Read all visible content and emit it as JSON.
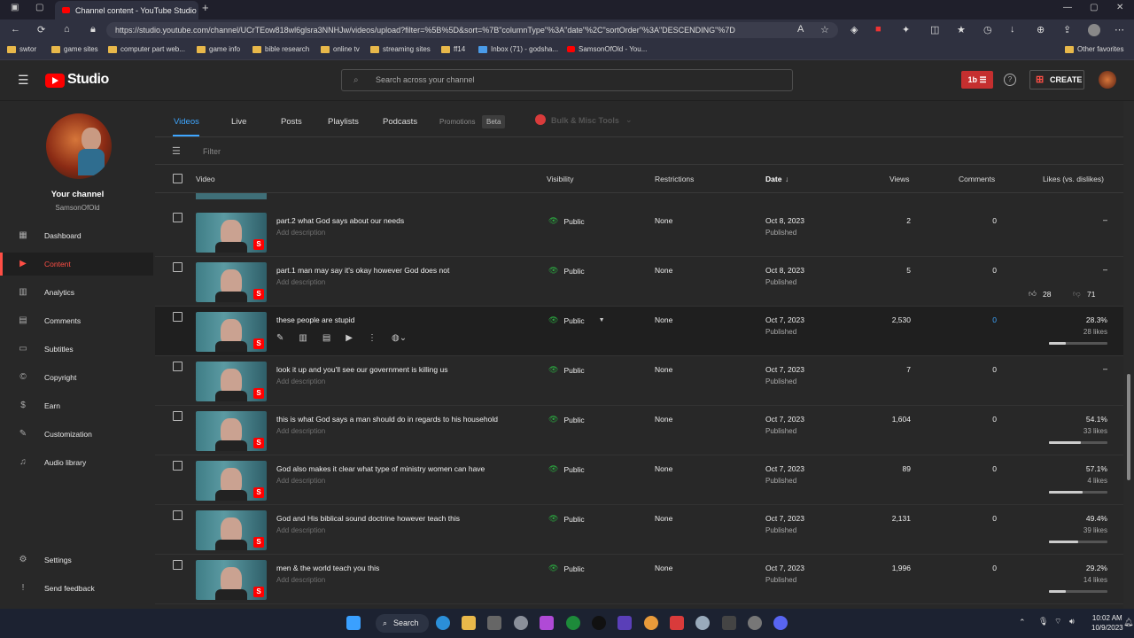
{
  "browser": {
    "tab_title": "Channel content - YouTube Studio",
    "url": "https://studio.youtube.com/channel/UCrTEow818wl6glsra3NNHJw/videos/upload?filter=%5B%5D&sort=%7B\"columnType\"%3A\"date\"%2C\"sortOrder\"%3A\"DESCENDING\"%7D",
    "bookmarks": [
      "swtor",
      "game sites",
      "computer part web...",
      "game info",
      "bible research",
      "online tv",
      "streaming sites",
      "ff14",
      "Inbox (71) - godsha...",
      "SamsonOfOld - You..."
    ],
    "other_favorites": "Other favorites"
  },
  "header": {
    "logo": "Studio",
    "search_placeholder": "Search across your channel",
    "create_label": "CREATE"
  },
  "sidebar": {
    "your_channel": "Your channel",
    "channel_name": "SamsonOfOld",
    "items": [
      {
        "label": "Dashboard",
        "icon": "dashboard-icon"
      },
      {
        "label": "Content",
        "icon": "content-icon",
        "active": true
      },
      {
        "label": "Analytics",
        "icon": "analytics-icon"
      },
      {
        "label": "Comments",
        "icon": "comments-icon"
      },
      {
        "label": "Subtitles",
        "icon": "subtitles-icon"
      },
      {
        "label": "Copyright",
        "icon": "copyright-icon"
      },
      {
        "label": "Earn",
        "icon": "earn-icon"
      },
      {
        "label": "Customization",
        "icon": "customization-icon"
      },
      {
        "label": "Audio library",
        "icon": "audio-library-icon"
      }
    ],
    "settings": "Settings",
    "feedback": "Send feedback"
  },
  "tabs": {
    "videos": "Videos",
    "live": "Live",
    "posts": "Posts",
    "playlists": "Playlists",
    "podcasts": "Podcasts",
    "promotions": "Promotions",
    "beta": "Beta",
    "bulk": "Bulk & Misc Tools"
  },
  "filter_placeholder": "Filter",
  "columns": {
    "video": "Video",
    "visibility": "Visibility",
    "restrictions": "Restrictions",
    "date": "Date",
    "views": "Views",
    "comments": "Comments",
    "likes": "Likes (vs. dislikes)"
  },
  "tooltip": {
    "likes": "28",
    "dislikes": "71"
  },
  "rows": [
    {
      "title": "part.2 what God says about our needs",
      "desc": "Add description",
      "visibility": "Public",
      "restrictions": "None",
      "date": "Oct 8, 2023",
      "status": "Published",
      "views": "2",
      "comments": "0",
      "likes_pct": "–",
      "likes_count": "",
      "bar": 0
    },
    {
      "title": "part.1 man may say it's okay however God does not",
      "desc": "Add description",
      "visibility": "Public",
      "restrictions": "None",
      "date": "Oct 8, 2023",
      "status": "Published",
      "views": "5",
      "comments": "0",
      "likes_pct": "–",
      "likes_count": "",
      "bar": 0
    },
    {
      "title": "these people are stupid",
      "desc": "",
      "visibility": "Public",
      "restrictions": "None",
      "date": "Oct 7, 2023",
      "status": "Published",
      "views": "2,530",
      "comments": "0",
      "likes_pct": "28.3%",
      "likes_count": "28 likes",
      "bar": 0.283
    },
    {
      "title": "look it up and you'll see our government is killing us",
      "desc": "Add description",
      "visibility": "Public",
      "restrictions": "None",
      "date": "Oct 7, 2023",
      "status": "Published",
      "views": "7",
      "comments": "0",
      "likes_pct": "–",
      "likes_count": "",
      "bar": 0
    },
    {
      "title": "this is what God says a man should do in regards to his household",
      "desc": "Add description",
      "visibility": "Public",
      "restrictions": "None",
      "date": "Oct 7, 2023",
      "status": "Published",
      "views": "1,604",
      "comments": "0",
      "likes_pct": "54.1%",
      "likes_count": "33 likes",
      "bar": 0.541
    },
    {
      "title": "God also makes it clear what type of ministry women can have",
      "desc": "Add description",
      "visibility": "Public",
      "restrictions": "None",
      "date": "Oct 7, 2023",
      "status": "Published",
      "views": "89",
      "comments": "0",
      "likes_pct": "57.1%",
      "likes_count": "4 likes",
      "bar": 0.571
    },
    {
      "title": "God and His biblical sound doctrine however teach this",
      "desc": "Add description",
      "visibility": "Public",
      "restrictions": "None",
      "date": "Oct 7, 2023",
      "status": "Published",
      "views": "2,131",
      "comments": "0",
      "likes_pct": "49.4%",
      "likes_count": "39 likes",
      "bar": 0.494
    },
    {
      "title": "men & the world teach you this",
      "desc": "Add description",
      "visibility": "Public",
      "restrictions": "None",
      "date": "Oct 7, 2023",
      "status": "Published",
      "views": "1,996",
      "comments": "0",
      "likes_pct": "29.2%",
      "likes_count": "14 likes",
      "bar": 0.292
    }
  ],
  "taskbar": {
    "search": "Search",
    "time": "10:02 AM",
    "date": "10/9/2023"
  },
  "colors": {
    "accent_blue": "#3ea6ff",
    "active_red": "#ff4e45",
    "public_green": "#2ba640"
  }
}
